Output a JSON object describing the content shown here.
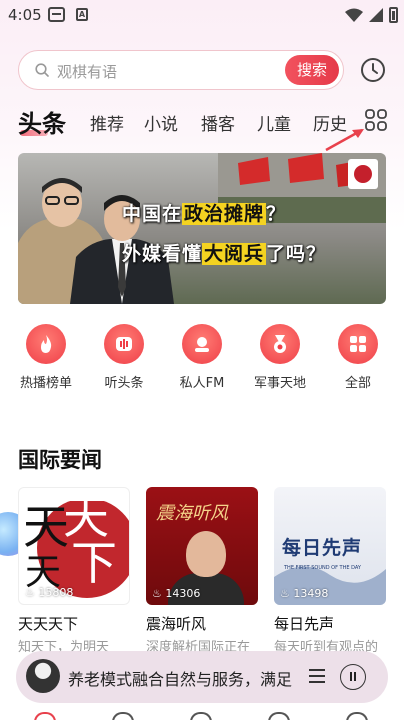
{
  "status_bar": {
    "time": "4:05",
    "notif_icon_letter": "A"
  },
  "search": {
    "placeholder": "观棋有语",
    "button_label": "搜索"
  },
  "tabs": [
    {
      "label": "头条",
      "active": true
    },
    {
      "label": "推荐"
    },
    {
      "label": "小说"
    },
    {
      "label": "播客"
    },
    {
      "label": "儿童"
    },
    {
      "label": "历史"
    }
  ],
  "banner": {
    "line1_a": "中国在",
    "line1_highlight": "政治摊牌",
    "line1_b": "？",
    "line2_a": "外媒看懂",
    "line2_highlight": "大阅兵",
    "line2_b": "了吗？"
  },
  "shortcuts": [
    {
      "label": "热播榜单",
      "icon": "flame-icon"
    },
    {
      "label": "听头条",
      "icon": "audio-wave-icon"
    },
    {
      "label": "私人FM",
      "icon": "radio-icon"
    },
    {
      "label": "军事天地",
      "icon": "medal-icon"
    },
    {
      "label": "全部",
      "icon": "grid-icon"
    }
  ],
  "section": {
    "title": "国际要闻"
  },
  "cards": [
    {
      "title": "天天天下",
      "subtitle": "知天下，为明天",
      "count": "15808",
      "cover_chars": [
        "天",
        "天",
        "天",
        "下"
      ]
    },
    {
      "title": "震海听风",
      "subtitle": "深度解析国际正在",
      "count": "14306",
      "cover_title": "震海听风"
    },
    {
      "title": "每日先声",
      "subtitle": "每天听到有观点的",
      "count": "13498",
      "cover_title": "每日先声",
      "cover_subtitle": "THE FIRST SOUND OF THE DAY"
    }
  ],
  "player": {
    "text": "养老模式融合自然与服务，满足"
  },
  "colors": {
    "accent": "#e8414c",
    "banner_highlight": "#f4d321"
  }
}
